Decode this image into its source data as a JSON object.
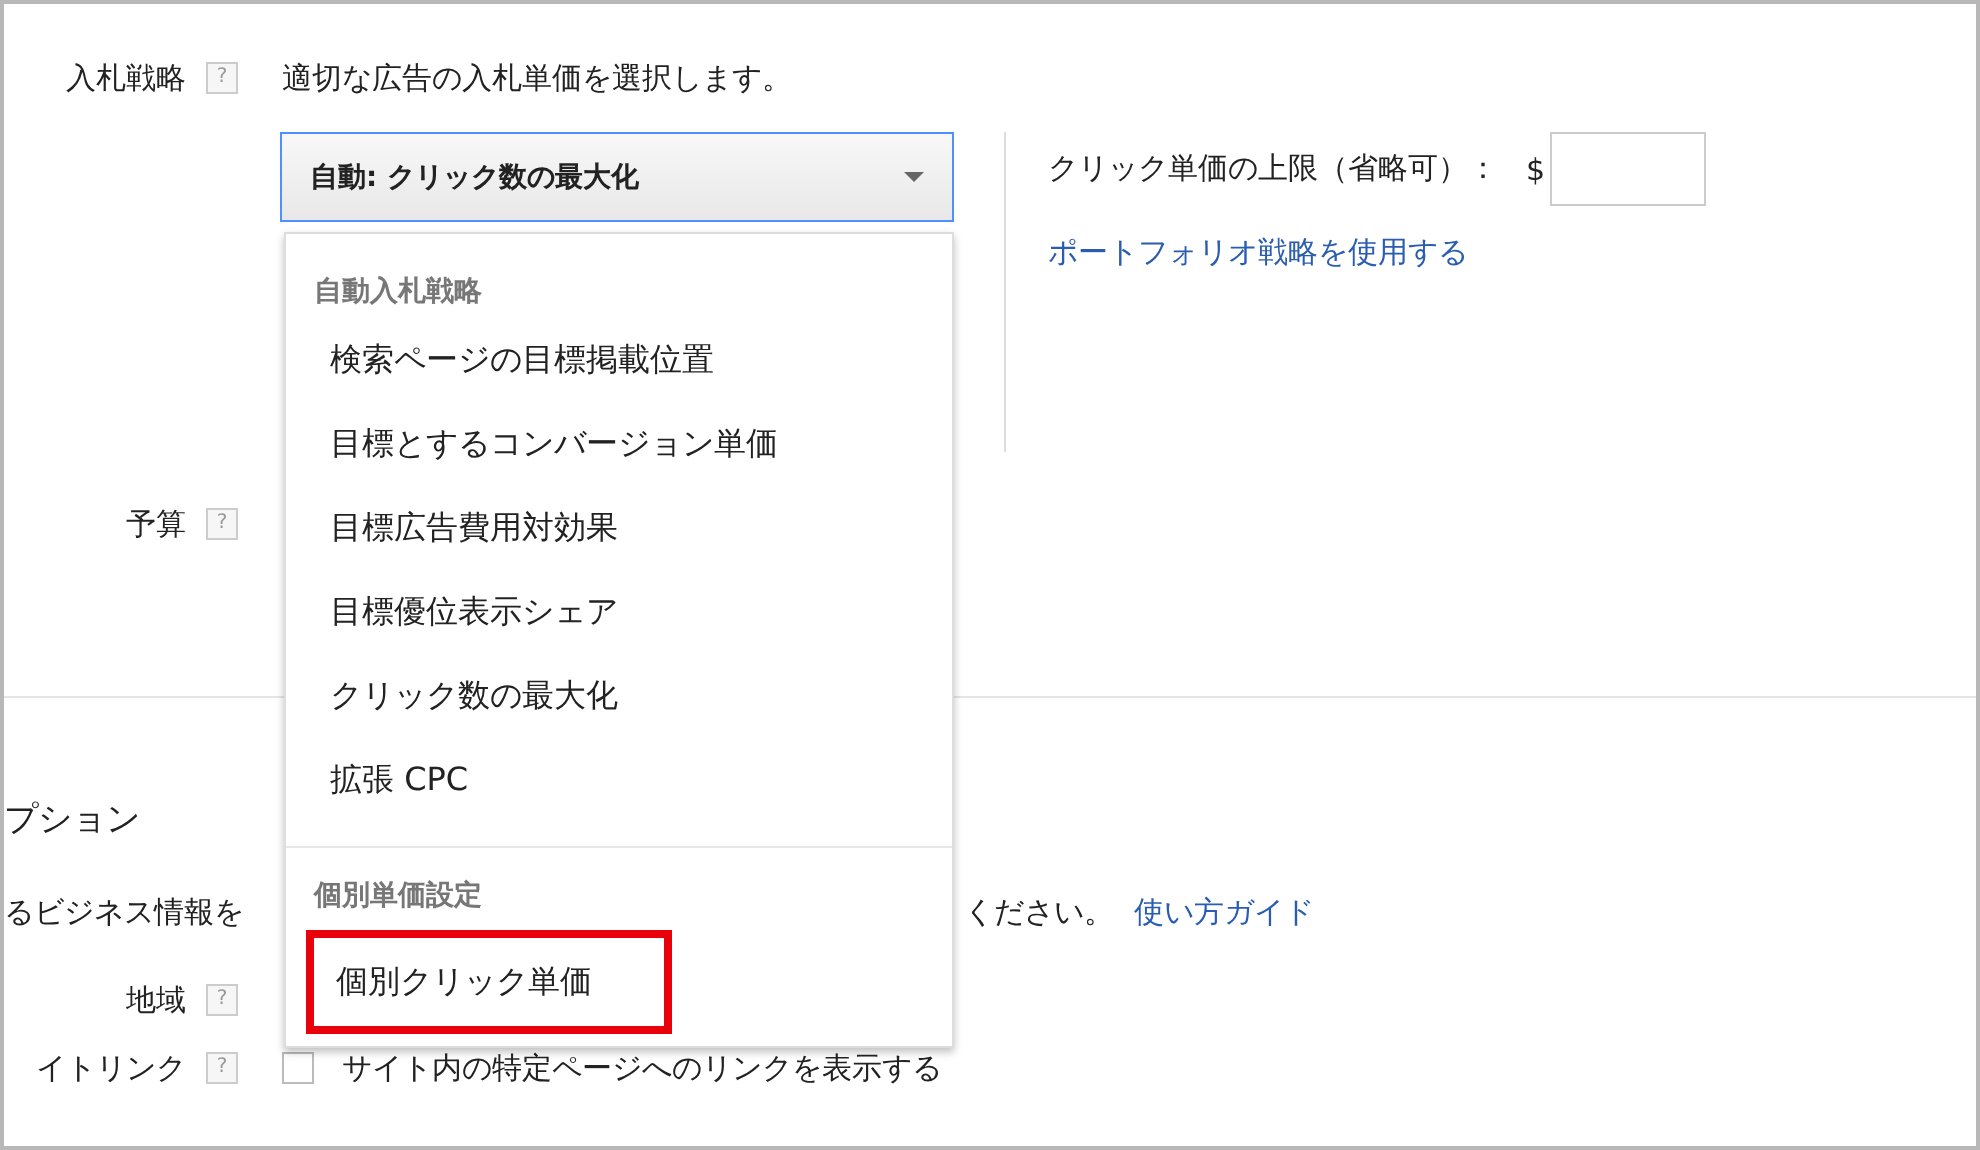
{
  "bid_strategy": {
    "label": "入札戦略",
    "help": "?",
    "description": "適切な広告の入札単価を選択します。",
    "select": {
      "value": "自動: クリック数の最大化",
      "expanded": true
    },
    "max_cpc": {
      "label": "クリック単価の上限（省略可）：",
      "currency": "$"
    },
    "portfolio_link": "ポートフォリオ戦略を使用する"
  },
  "budget": {
    "label": "予算",
    "help": "?"
  },
  "options": {
    "title": "プション",
    "extension_text": "るビジネス情報を",
    "extension_text_end": "ください。",
    "guide_link": "使い方ガイド",
    "region": {
      "label": "地域",
      "help": "?"
    },
    "sitelinks": {
      "label": "イトリンク",
      "help": "?",
      "checkbox_label": "サイト内の特定ページへのリンクを表示する",
      "checked": false
    }
  },
  "dropdown": {
    "groups": [
      {
        "heading": "自動入札戦略",
        "items": [
          {
            "label": "検索ページの目標掲載位置",
            "highlighted": false
          },
          {
            "label": "目標とするコンバージョン単価",
            "highlighted": false
          },
          {
            "label": "目標広告費用対効果",
            "highlighted": false
          },
          {
            "label": "目標優位表示シェア",
            "highlighted": false
          },
          {
            "label": "クリック数の最大化",
            "highlighted": false
          },
          {
            "label": "拡張 CPC",
            "highlighted": false
          }
        ]
      },
      {
        "heading": "個別単価設定",
        "items": [
          {
            "label": "個別クリック単価",
            "highlighted": true
          }
        ]
      }
    ]
  }
}
